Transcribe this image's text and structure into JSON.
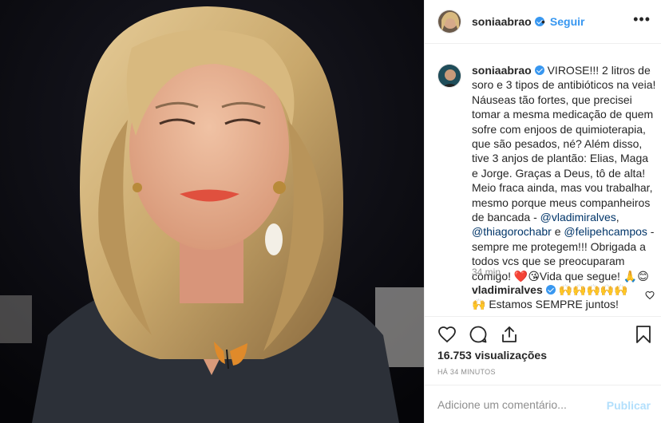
{
  "post": {
    "username": "soniaabrao",
    "follow_label": "Seguir",
    "more_icon": "more-options-icon",
    "caption_parts": {
      "p1": "VIROSE!!! 2 litros de soro e 3 tipos de antibióticos na veia! Náuseas tão fortes, que precisei tomar a mesma medicação de quem sofre com enjoos de quimioterapia, que são pesados, né? Além disso, tive 3 anjos de plantão: Elias, Maga e Jorge. Graças a Deus, tô de alta! Meio fraca ainda, mas vou trabalhar, mesmo porque meus companheiros de bancada - ",
      "m1": "@vladimiralves",
      "p2": ", ",
      "m2": "@thiagorochabr",
      "p3": " e ",
      "m3": "@felipehcampos",
      "p4": " - sempre me protegem!!! Obrigada a todos vcs que se preocuparam comigo! ❤️😘Vida que segue! 🙏😊"
    },
    "time_ago": "34 min"
  },
  "comment": {
    "username": "vladimiralves",
    "text": "🙌🙌🙌🙌🙌🙌 Estamos SEMPRE juntos!"
  },
  "stats": {
    "views": "16.753 visualizações",
    "posted": "HÁ 34 MINUTOS"
  },
  "composer": {
    "placeholder": "Adicione um comentário...",
    "publish_label": "Publicar"
  },
  "colors": {
    "accent": "#3897f0",
    "publish_disabled": "#b2dffc",
    "mention": "#003569"
  }
}
